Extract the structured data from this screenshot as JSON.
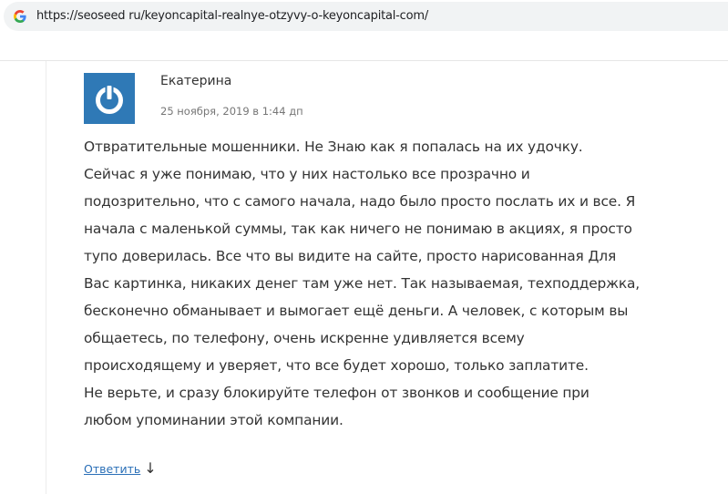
{
  "browser": {
    "url": "https://seoseed ru/keyoncapital-realnye-otzyvy-o-keyoncapital-com/",
    "site_icon": "google-g-icon"
  },
  "comment": {
    "author": "Екатерина",
    "date": "25 ноября, 2019 в 1:44 дп",
    "avatar_icon": "power-icon",
    "avatar_color": "#2f79b6",
    "text_lines": [
      "Отвратительные мошенники. Не Знаю как я попалась на их удочку.",
      "Сейчас я уже понимаю, что у них настолько все прозрачно и",
      "подозрительно, что с самого начала, надо было просто послать их и все. Я",
      "начала с маленькой суммы, так как ничего не понимаю в акциях, я просто",
      "тупо доверилась. Все что вы видите на сайте, просто нарисованная Для",
      "Вас картинка, никаких денег там уже нет. Так называемая, техподдержка,",
      "бесконечно обманывает и вымогает ещё деньги. А человек, с которым вы",
      "общаетесь, по телефону, очень искренне удивляется всему",
      "происходящему и уверяет, что все будет хорошо, только заплатите.",
      "Не верьте, и сразу блокируйте телефон от звонков и сообщение при",
      "любом упоминании этой компании."
    ],
    "reply_label": "Ответить",
    "reply_arrow": "↓"
  }
}
